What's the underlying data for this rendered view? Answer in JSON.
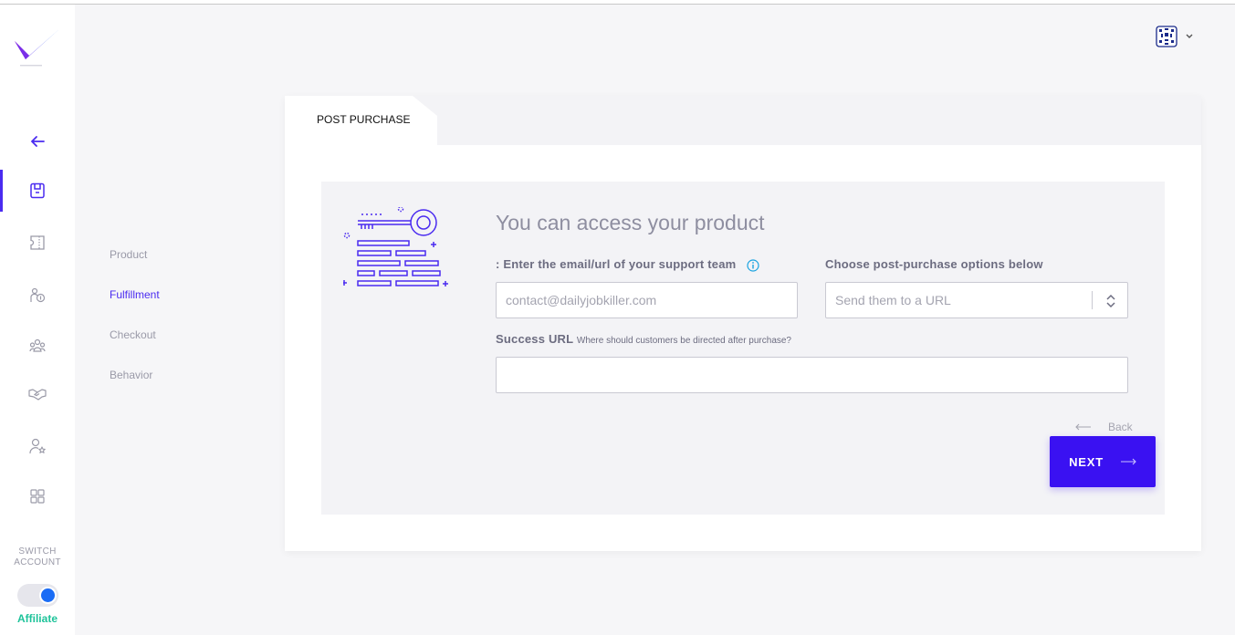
{
  "sidebar": {
    "switch_label": "SWITCH ACCOUNT",
    "account_mode": "Affiliate",
    "icons": [
      "back-arrow-icon",
      "product-box-icon",
      "ticket-icon",
      "sales-icon",
      "customers-icon",
      "handshake-icon",
      "user-star-icon",
      "apps-grid-icon"
    ]
  },
  "steps": {
    "items": [
      "Product",
      "Fulfillment",
      "Checkout",
      "Behavior"
    ],
    "current": "Fulfillment"
  },
  "card": {
    "tab_label": "POST PURCHASE",
    "headline": "You can access your product",
    "support_label": ": Enter the email/url of your support team",
    "support_placeholder": "contact@dailyjobkiller.com",
    "options_label": "Choose post-purchase options below",
    "options_selected": "Send them to a URL",
    "success_label": "Success URL",
    "success_hint": "Where should customers be directed after purchase?",
    "success_value": "",
    "back_label": "Back",
    "next_label": "NEXT"
  },
  "colors": {
    "accent": "#3a11f2",
    "affiliate_green": "#1ec39a",
    "toggle_knob": "#1a6cf5",
    "info_blue": "#1aa3e0"
  }
}
